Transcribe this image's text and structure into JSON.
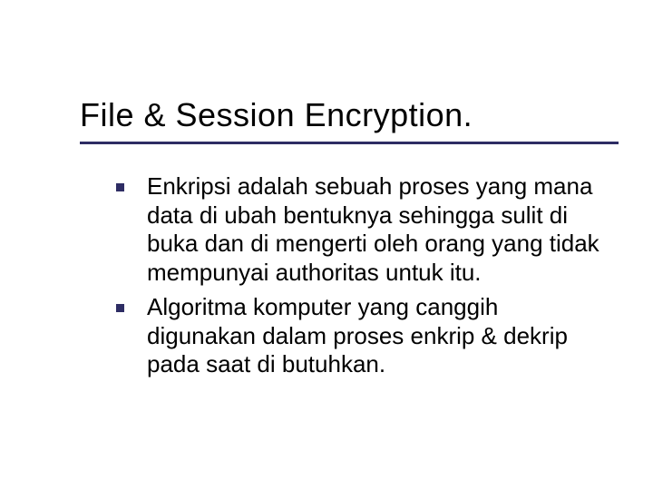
{
  "title": "File & Session Encryption.",
  "bullets": [
    "Enkripsi adalah sebuah proses yang mana data di ubah bentuknya sehingga sulit di buka dan di mengerti oleh orang yang tidak mempunyai authoritas untuk itu.",
    "Algoritma komputer yang canggih digunakan dalam proses enkrip & dekrip pada saat di butuhkan."
  ]
}
